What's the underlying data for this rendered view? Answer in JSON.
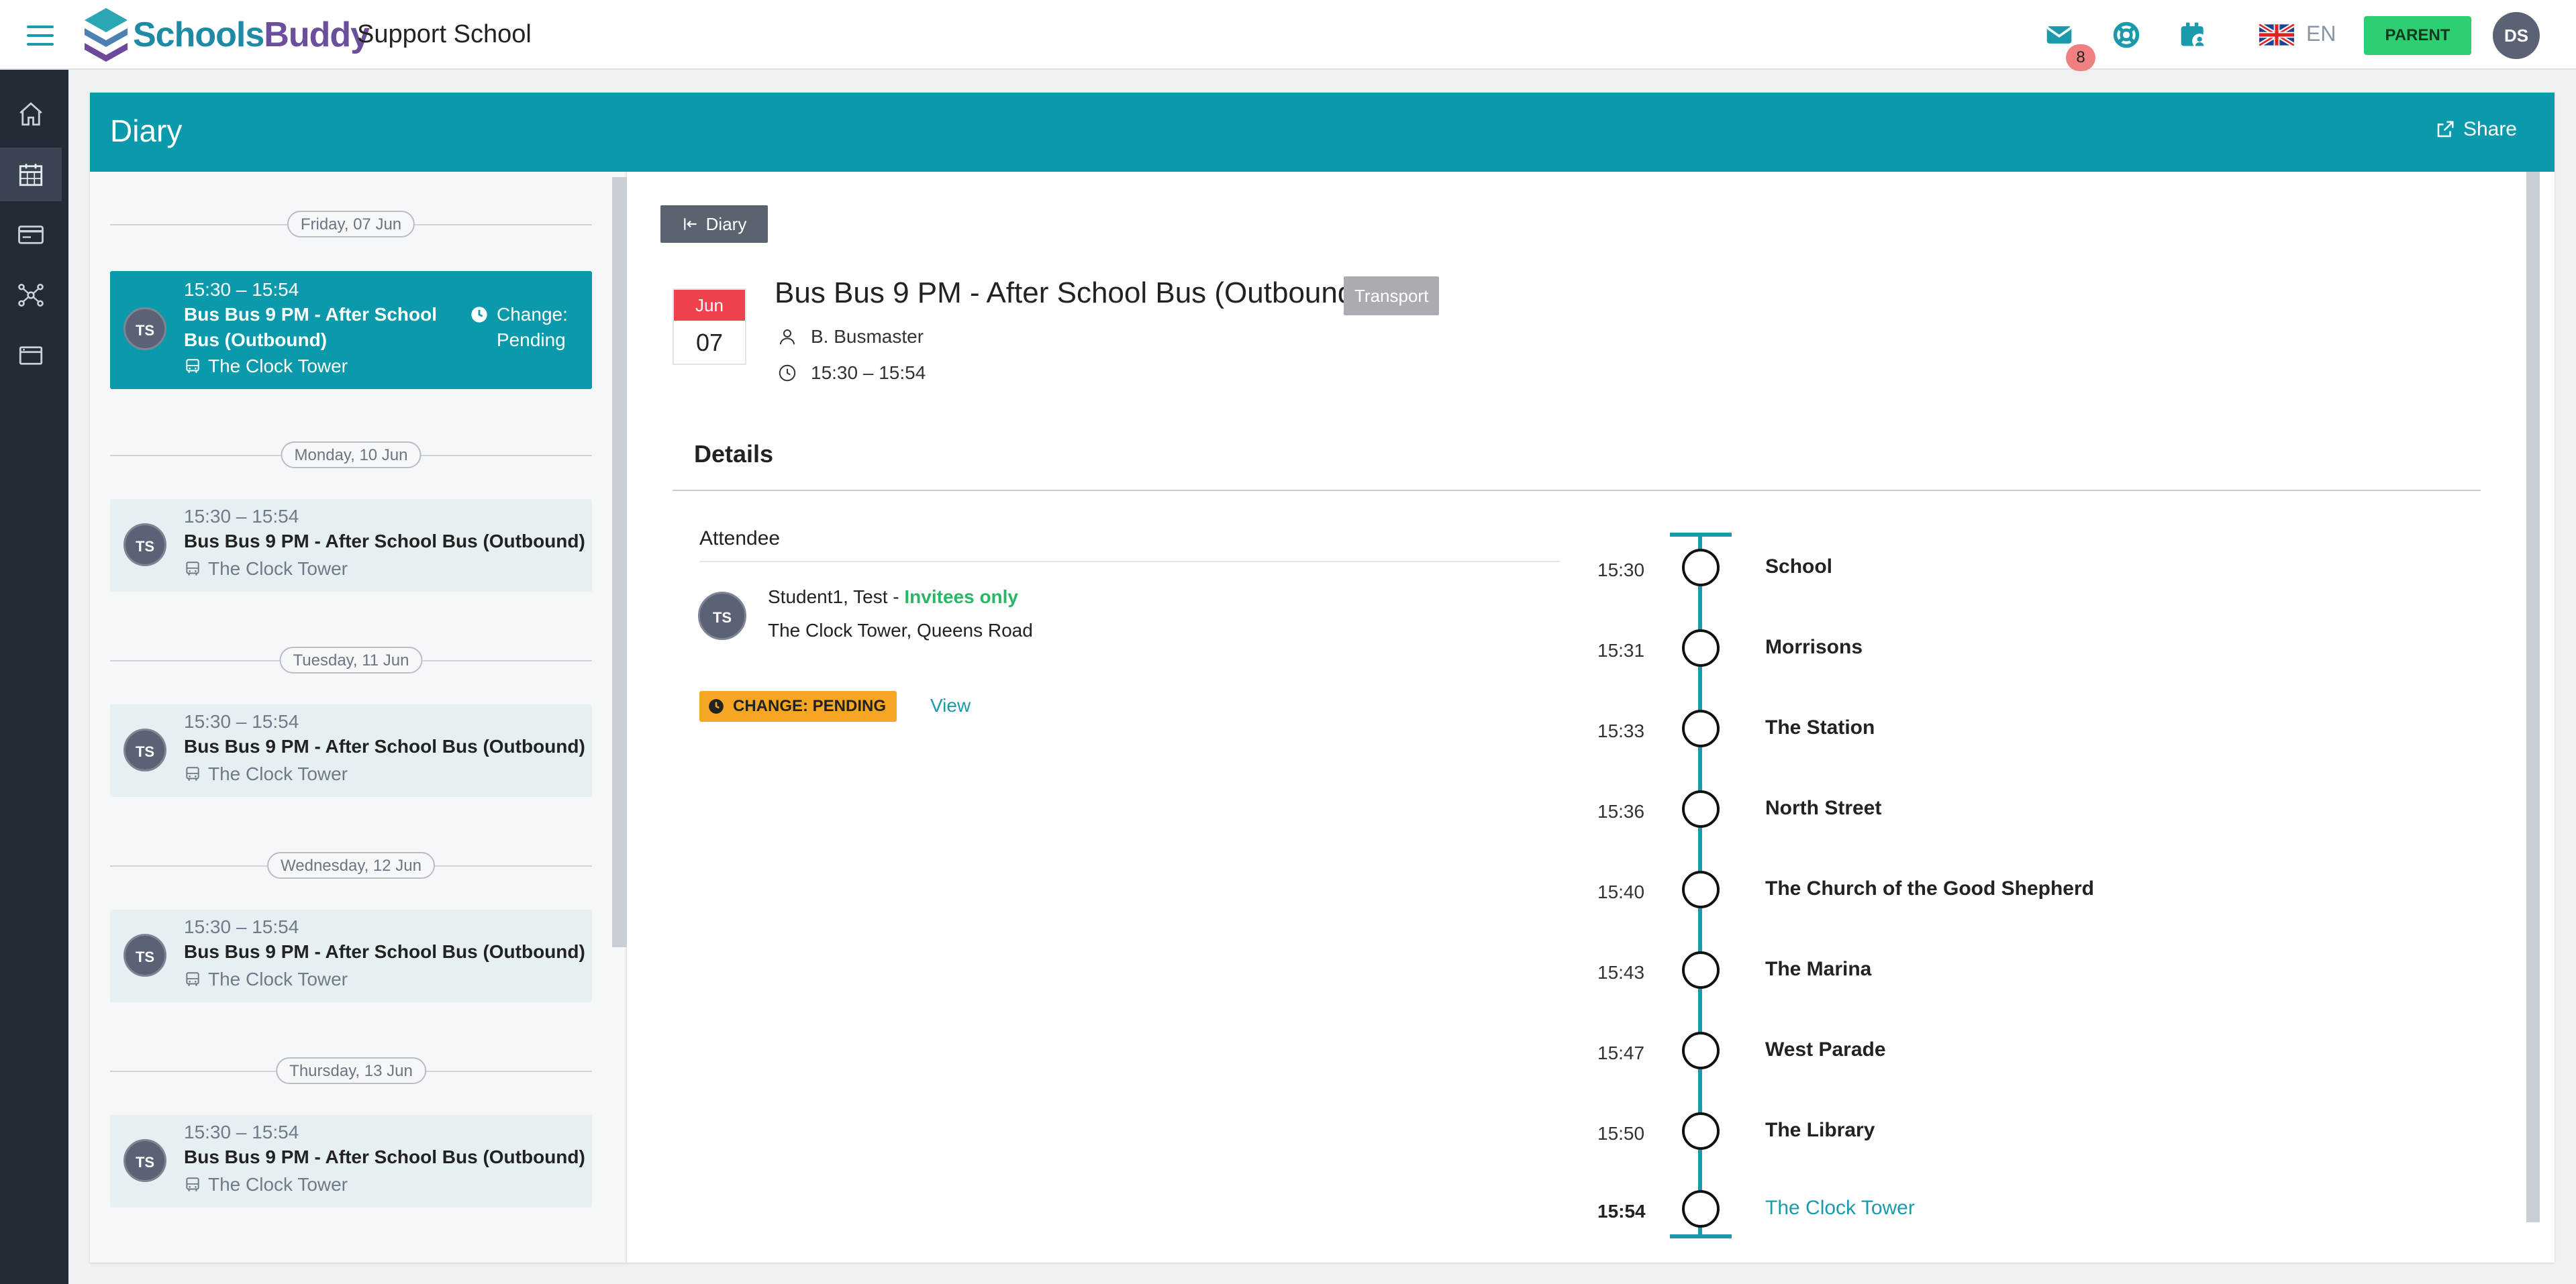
{
  "header": {
    "brand_part1": "Schools",
    "brand_part2": "Buddy",
    "school_name": "Support School",
    "message_count": "8",
    "language": "EN",
    "role_button": "PARENT",
    "user_initials": "DS"
  },
  "nav": {
    "items": [
      "home-icon",
      "calendar-icon",
      "card-icon",
      "network-icon",
      "window-icon"
    ],
    "active": "calendar-icon"
  },
  "page": {
    "title": "Diary",
    "share_label": "Share"
  },
  "list": {
    "days": [
      {
        "date": "Friday, 07 Jun",
        "events": [
          {
            "time": "15:30 – 15:54",
            "title": "Bus Bus 9 PM - After School Bus (Outbound)",
            "location": "The Clock Tower",
            "initials": "TS",
            "status": "Change: Pending",
            "selected": true
          }
        ]
      },
      {
        "date": "Monday, 10 Jun",
        "events": [
          {
            "time": "15:30 – 15:54",
            "title": "Bus Bus 9 PM - After School Bus (Outbound)",
            "location": "The Clock Tower",
            "initials": "TS"
          }
        ]
      },
      {
        "date": "Tuesday, 11 Jun",
        "events": [
          {
            "time": "15:30 – 15:54",
            "title": "Bus Bus 9 PM - After School Bus (Outbound)",
            "location": "The Clock Tower",
            "initials": "TS"
          }
        ]
      },
      {
        "date": "Wednesday, 12 Jun",
        "events": [
          {
            "time": "15:30 – 15:54",
            "title": "Bus Bus 9 PM - After School Bus (Outbound)",
            "location": "The Clock Tower",
            "initials": "TS"
          }
        ]
      },
      {
        "date": "Thursday, 13 Jun",
        "events": [
          {
            "time": "15:30 – 15:54",
            "title": "Bus Bus 9 PM - After School Bus (Outbound)",
            "location": "The Clock Tower",
            "initials": "TS"
          }
        ]
      }
    ]
  },
  "detail": {
    "back_label": "Diary",
    "month": "Jun",
    "day": "07",
    "title": "Bus Bus 9 PM - After School Bus (Outbound)",
    "tag": "Transport",
    "organiser": "B. Busmaster",
    "time": "15:30 – 15:54",
    "details_heading": "Details",
    "attendee_heading": "Attendee",
    "attendee": {
      "initials": "TS",
      "name": "Student1, Test - ",
      "visibility": "Invitees only",
      "address": "The Clock Tower, Queens Road"
    },
    "status_badge": "CHANGE: PENDING",
    "view_link": "View",
    "stops": [
      {
        "time": "15:30",
        "name": "School"
      },
      {
        "time": "15:31",
        "name": "Morrisons"
      },
      {
        "time": "15:33",
        "name": "The Station"
      },
      {
        "time": "15:36",
        "name": "North Street"
      },
      {
        "time": "15:40",
        "name": "The Church of the Good Shepherd"
      },
      {
        "time": "15:43",
        "name": "The Marina"
      },
      {
        "time": "15:47",
        "name": "West Parade"
      },
      {
        "time": "15:50",
        "name": "The Library"
      },
      {
        "time": "15:54",
        "name": "The Clock Tower",
        "destination": true
      }
    ]
  },
  "colors": {
    "accent": "#0a9aab",
    "sidebar": "#222b36",
    "pending": "#f6a623",
    "invitees": "#29b765",
    "calendar_month": "#f0414f",
    "parent_button": "#2ecf73"
  }
}
